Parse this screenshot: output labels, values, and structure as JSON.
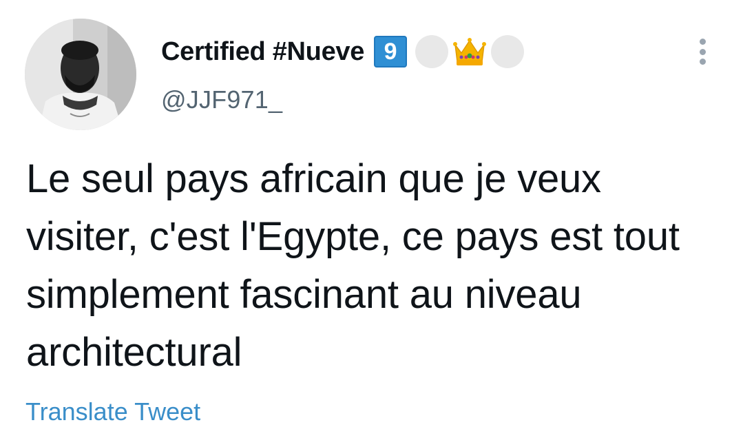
{
  "author": {
    "display_name": "Certified #Nueve",
    "badge_text": "9",
    "handle": "@JJF971_",
    "avatar_icon": "user-avatar",
    "emoji_icons": [
      "white-circle-icon",
      "crown-icon",
      "white-circle-icon"
    ]
  },
  "tweet": {
    "text": "Le seul pays africain que je veux visiter, c'est l'Egypte, ce pays est tout simplement fascinant au niveau architectural"
  },
  "actions": {
    "translate_label": "Translate Tweet",
    "more_icon": "more-vertical-icon"
  },
  "colors": {
    "text": "#0f1419",
    "secondary": "#536471",
    "link": "#3a8ec9",
    "badge": "#2f8fd4"
  }
}
